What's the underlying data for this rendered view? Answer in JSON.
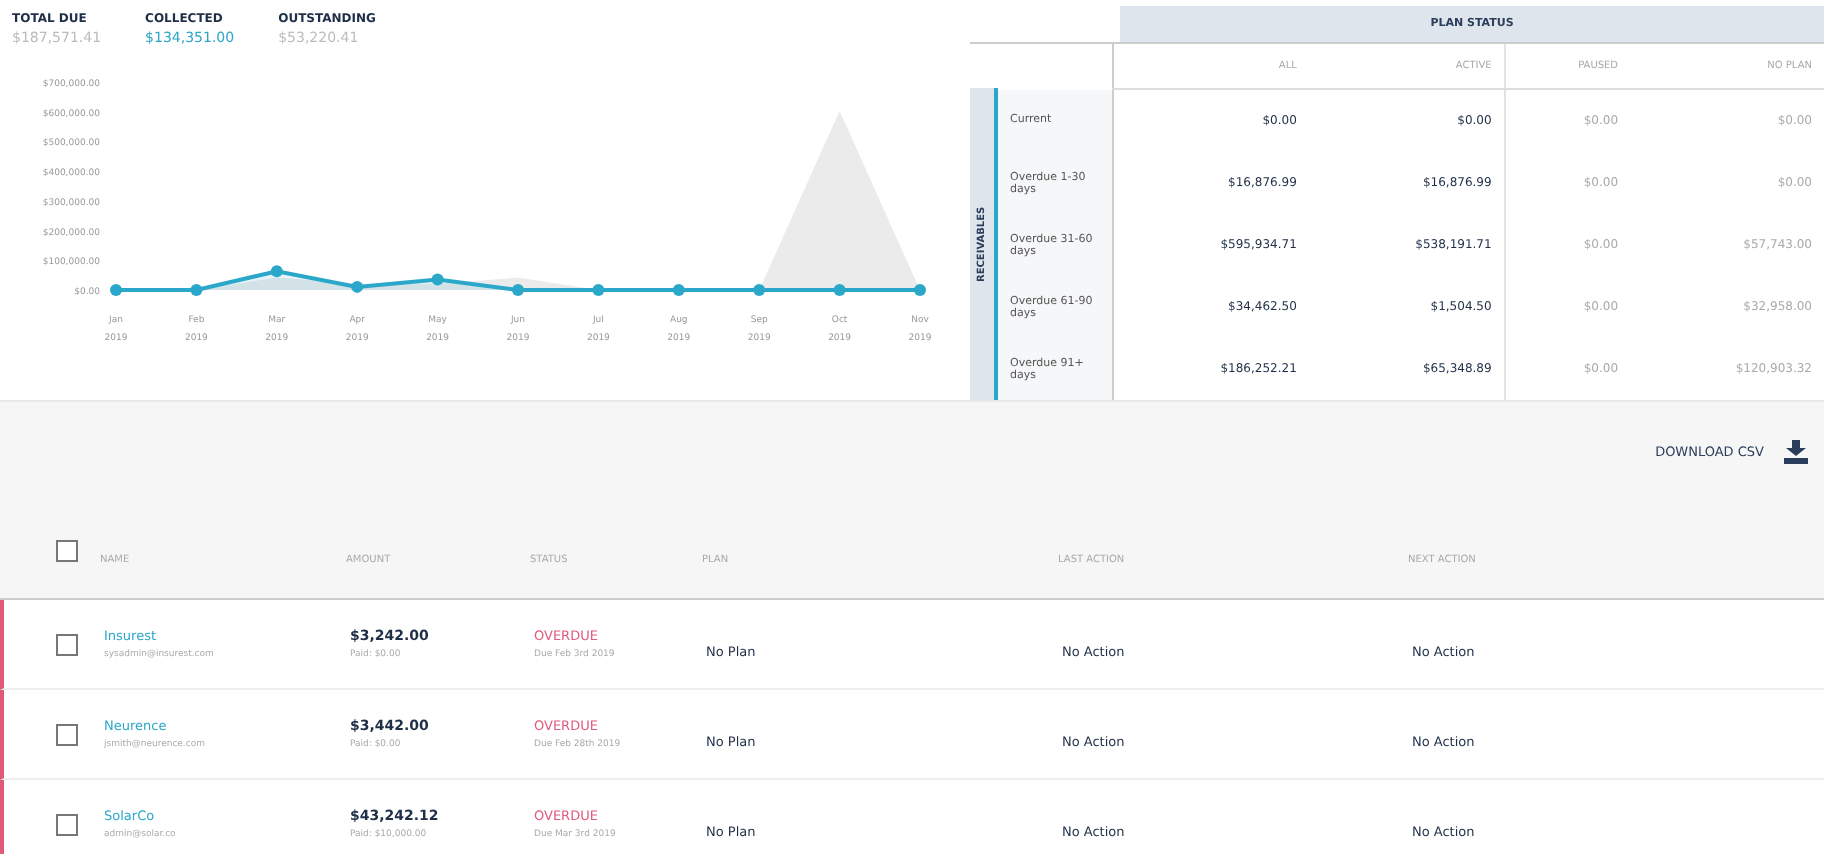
{
  "summary": [
    {
      "label": "TOTAL DUE",
      "value": "$187,571.41",
      "kind": "muted"
    },
    {
      "label": "COLLECTED",
      "value": "$134,351.00",
      "kind": "accent"
    },
    {
      "label": "OUTSTANDING",
      "value": "$53,220.41",
      "kind": "muted"
    }
  ],
  "chart": {
    "x_labels": [
      "Jan 2019",
      "Feb 2019",
      "Mar 2019",
      "Apr 2019",
      "May 2019",
      "Jun 2019",
      "Jul 2019",
      "Aug 2019",
      "Sep 2019",
      "Oct 2019",
      "Nov 2019"
    ],
    "y_labels": [
      "$700,000.00",
      "$600,000.00",
      "$500,000.00",
      "$400,000.00",
      "$300,000.00",
      "$200,000.00",
      "$100,000.00",
      "$0.00"
    ]
  },
  "plan_status": {
    "title": "PLAN STATUS",
    "side_label": "RECEIVABLES",
    "columns": [
      "ALL",
      "ACTIVE",
      "PAUSED",
      "NO PLAN"
    ],
    "rows": [
      {
        "label": "Current",
        "cells": [
          "$0.00",
          "$0.00",
          "$0.00",
          "$0.00"
        ]
      },
      {
        "label": "Overdue 1-30 days",
        "cells": [
          "$16,876.99",
          "$16,876.99",
          "$0.00",
          "$0.00"
        ]
      },
      {
        "label": "Overdue 31-60 days",
        "cells": [
          "$595,934.71",
          "$538,191.71",
          "$0.00",
          "$57,743.00"
        ]
      },
      {
        "label": "Overdue 61-90 days",
        "cells": [
          "$34,462.50",
          "$1,504.50",
          "$0.00",
          "$32,958.00"
        ]
      },
      {
        "label": "Overdue 91+ days",
        "cells": [
          "$186,252.21",
          "$65,348.89",
          "$0.00",
          "$120,903.32"
        ]
      }
    ]
  },
  "download_button": "DOWNLOAD CSV",
  "accounts": {
    "select_all_checked": false,
    "columns": [
      "NAME",
      "AMOUNT",
      "STATUS",
      "PLAN",
      "LAST ACTION",
      "NEXT ACTION"
    ],
    "rows": [
      {
        "checked": false,
        "name": "Insurest",
        "email": "sysadmin@insurest.com",
        "amount": "$3,242.00",
        "amount_note": "Paid: $0.00",
        "status": "OVERDUE",
        "due": "Due Feb 3rd 2019",
        "plan": "No Plan",
        "last_action": "No Action",
        "next_action": "No Action"
      },
      {
        "checked": false,
        "name": "Neurence",
        "email": "jsmith@neurence.com",
        "amount": "$3,442.00",
        "amount_note": "Paid: $0.00",
        "status": "OVERDUE",
        "due": "Due Feb 28th 2019",
        "plan": "No Plan",
        "last_action": "No Action",
        "next_action": "No Action"
      },
      {
        "checked": false,
        "name": "SolarCo",
        "email": "admin@solar.co",
        "amount": "$43,242.12",
        "amount_note": "Paid: $10,000.00",
        "status": "OVERDUE",
        "due": "Due Mar 3rd 2019",
        "plan": "No Plan",
        "last_action": "No Action",
        "next_action": "No Action"
      }
    ]
  }
}
